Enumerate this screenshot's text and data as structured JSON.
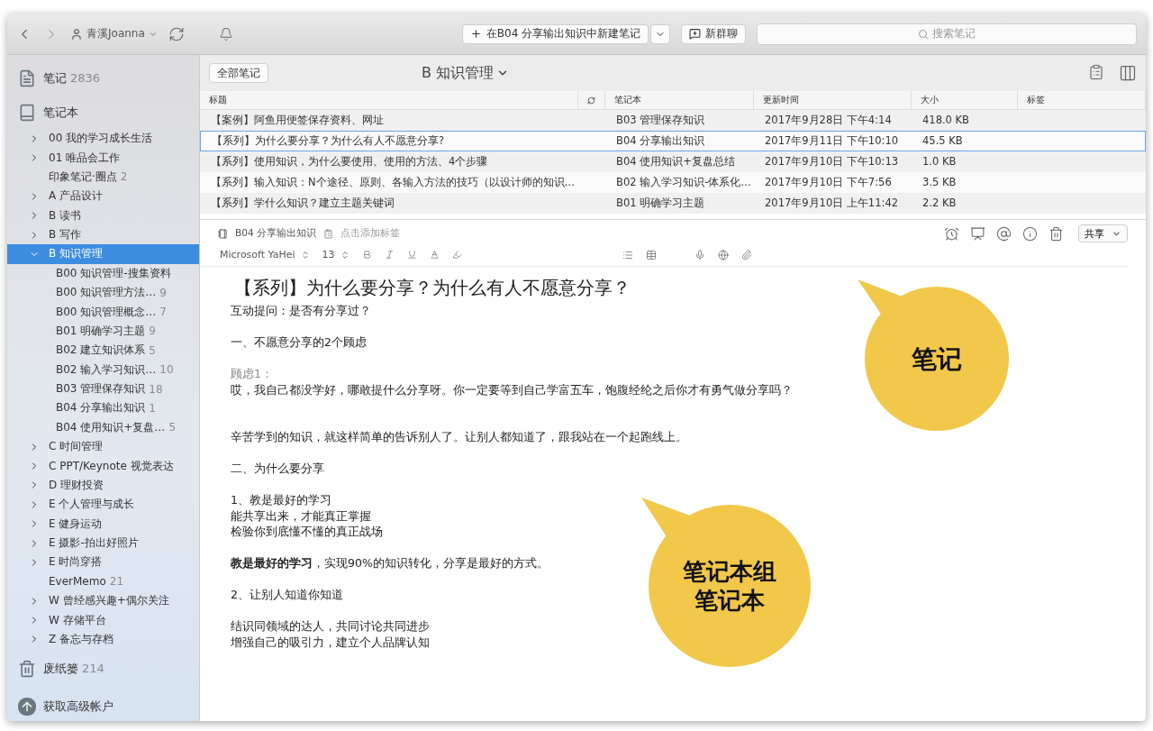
{
  "toolbar": {
    "user": "青溪Joanna",
    "new_note": "在B04 分享输出知识中新建笔记",
    "group_chat": "新群聊",
    "search": {
      "placeholder": "搜索笔记"
    }
  },
  "sidebar": {
    "notes": {
      "label": "笔记",
      "count": "2836"
    },
    "notebooks_label": "笔记本",
    "notebooks": [
      {
        "name": "00 我的学习成长生活",
        "expanded": false,
        "selected": false
      },
      {
        "name": "01 唯品会工作",
        "expanded": false,
        "selected": false
      },
      {
        "name": "印象笔记·圈点",
        "count": "2",
        "selected": false
      },
      {
        "name": "A 产品设计",
        "expanded": false,
        "selected": false
      },
      {
        "name": "B 读书",
        "expanded": false,
        "selected": false
      },
      {
        "name": "B 写作",
        "expanded": false,
        "selected": false
      },
      {
        "name": "B 知识管理",
        "expanded": true,
        "selected": true,
        "children": [
          {
            "name": "B00 知识管理-搜集资料",
            "selected": false
          },
          {
            "name": "B00 知识管理方法…",
            "count": "9",
            "selected": false
          },
          {
            "name": "B00 知识管理概念…",
            "count": "7",
            "selected": false
          },
          {
            "name": "B01 明确学习主题",
            "count": "9",
            "selected": false
          },
          {
            "name": "B02 建立知识体系",
            "count": "5",
            "selected": false
          },
          {
            "name": "B02 输入学习知识…",
            "count": "10",
            "selected": false
          },
          {
            "name": "B03 管理保存知识",
            "count": "18",
            "selected": false
          },
          {
            "name": "B04 分享输出知识",
            "count": "1",
            "selected": false
          },
          {
            "name": "B04 使用知识+复盘…",
            "count": "5",
            "selected": false
          }
        ]
      },
      {
        "name": "C 时间管理",
        "expanded": false,
        "selected": false
      },
      {
        "name": "C PPT/Keynote 视觉表达",
        "expanded": false,
        "selected": false
      },
      {
        "name": "D 理财投资",
        "expanded": false,
        "selected": false
      },
      {
        "name": "E 个人管理与成长",
        "expanded": false,
        "selected": false
      },
      {
        "name": "E 健身运动",
        "expanded": false,
        "selected": false
      },
      {
        "name": "E 摄影-拍出好照片",
        "expanded": false,
        "selected": false
      },
      {
        "name": "E 时尚穿搭",
        "expanded": false,
        "selected": false
      },
      {
        "name": "EverMemo",
        "count": "21",
        "selected": false
      },
      {
        "name": "W 曾经感兴趣+偶尔关注",
        "expanded": false,
        "selected": false
      },
      {
        "name": "W 存储平台",
        "expanded": false,
        "selected": false
      },
      {
        "name": "Z 备忘与存档",
        "expanded": false,
        "selected": false
      }
    ],
    "trash": {
      "label": "废纸篓",
      "count": "214"
    },
    "upgrade": "获取高级帐户"
  },
  "list": {
    "all_button": "全部笔记",
    "title": "B 知识管理",
    "columns": [
      "标题",
      "笔记本",
      "更新时间",
      "大小",
      "标签"
    ],
    "rows": [
      {
        "title": "【案例】阿鱼用便签保存资料、网址",
        "notebook": "B03 管理保存知识",
        "updated": "2017年9月28日 下午4:14",
        "size": "418.0 KB",
        "selected": false
      },
      {
        "title": "【系列】为什么要分享？为什么有人不愿意分享?",
        "notebook": "B04 分享输出知识",
        "updated": "2017年9月11日 下午10:10",
        "size": "45.5 KB",
        "selected": true
      },
      {
        "title": "【系列】使用知识，为什么要使用、使用的方法、4个步骤",
        "notebook": "B04 使用知识+复盘总结",
        "updated": "2017年9月10日 下午10:13",
        "size": "1.0 KB",
        "selected": false
      },
      {
        "title": "【系列】输入知识：N个途径、原则、各输入方法的技巧（以设计师的知识…",
        "notebook": "B02 输入学习知识-体系化…",
        "updated": "2017年9月10日 下午7:56",
        "size": "3.5 KB",
        "selected": false
      },
      {
        "title": "【系列】学什么知识？建立主题关键词",
        "notebook": "B01 明确学习主题",
        "updated": "2017年9月10日 上午11:42",
        "size": "2.2 KB",
        "selected": false
      }
    ]
  },
  "note": {
    "notebook": "B04 分享输出知识",
    "tag_placeholder": "点击添加标签",
    "share": "共享",
    "font": "Microsoft YaHei",
    "font_size": "13",
    "title": "【系列】为什么要分享？为什么有人不愿意分享？",
    "lines": [
      {
        "kind": "text",
        "text": "互动提问：是否有分享过？"
      },
      {
        "kind": "blank"
      },
      {
        "kind": "text",
        "text": "一、不愿意分享的2个顾虑"
      },
      {
        "kind": "blank"
      },
      {
        "kind": "text",
        "text": "顾虑1：",
        "muted": true
      },
      {
        "kind": "text",
        "text": "哎，我自己都没学好，哪敢提什么分享呀。你一定要等到自己学富五车，饱腹经纶之后你才有勇气做分享吗？"
      },
      {
        "kind": "blank"
      },
      {
        "kind": "blank"
      },
      {
        "kind": "text",
        "text": "辛苦学到的知识，就这样简单的告诉别人了。让别人都知道了，跟我站在一个起跑线上。"
      },
      {
        "kind": "blank"
      },
      {
        "kind": "text",
        "text": "二、为什么要分享"
      },
      {
        "kind": "blank"
      },
      {
        "kind": "text",
        "text": "1、教是最好的学习"
      },
      {
        "kind": "text",
        "text": "能共享出来，才能真正掌握"
      },
      {
        "kind": "text",
        "text": "检验你到底懂不懂的真正战场"
      },
      {
        "kind": "blank"
      },
      {
        "kind": "text",
        "text": "**教是最好的学习**，实现90%的知识转化，分享是最好的方式。"
      },
      {
        "kind": "blank"
      },
      {
        "kind": "text",
        "text": "2、让别人知道你知道"
      },
      {
        "kind": "blank"
      },
      {
        "kind": "text",
        "text": "结识同领域的达人，共同讨论共同进步"
      },
      {
        "kind": "text",
        "text": "增强自己的吸引力，建立个人品牌认知"
      }
    ]
  },
  "callouts": [
    {
      "lines": [
        "笔记"
      ]
    },
    {
      "lines": [
        "笔记本组",
        "笔记本"
      ]
    }
  ]
}
